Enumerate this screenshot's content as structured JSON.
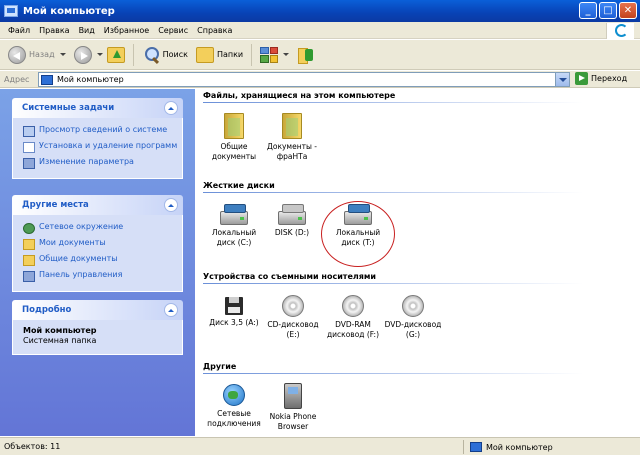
{
  "window": {
    "title": "Мой компьютер"
  },
  "menu": [
    "Файл",
    "Правка",
    "Вид",
    "Избранное",
    "Сервис",
    "Справка"
  ],
  "toolbar": {
    "back": "Назад",
    "search": "Поиск",
    "folders": "Папки"
  },
  "address": {
    "label": "Адрес",
    "value": "Мой компьютер",
    "go": "Переход"
  },
  "left": {
    "system_tasks": {
      "title": "Системные задачи",
      "items": [
        "Просмотр сведений о системе",
        "Установка и удаление программ",
        "Изменение параметра"
      ]
    },
    "other_places": {
      "title": "Другие места",
      "items": [
        "Сетевое окружение",
        "Мои документы",
        "Общие документы",
        "Панель управления"
      ]
    },
    "details": {
      "title": "Подробно",
      "name": "Мой компьютер",
      "type": "Системная папка"
    }
  },
  "groups": {
    "files": {
      "title": "Файлы, хранящиеся на этом компьютере",
      "items": [
        "Общие документы",
        "Документы - фраНТа"
      ]
    },
    "drives": {
      "title": "Жесткие диски",
      "items": [
        "Локальный диск (C:)",
        "DISK (D:)",
        "Локальный диск (T:)"
      ]
    },
    "removable": {
      "title": "Устройства со съемными носителями",
      "items": [
        "Диск 3,5 (A:)",
        "CD-дисковод (E:)",
        "DVD-RAM дисковод (F:)",
        "DVD-дисковод (G:)"
      ]
    },
    "other": {
      "title": "Другие",
      "items": [
        "Сетевые подключения",
        "Nokia Phone Browser"
      ]
    }
  },
  "status": {
    "objects": "Объектов: 11",
    "location": "Мой компьютер"
  },
  "colors": {
    "titlebar": "#0842b5",
    "task_link": "#215dc6",
    "highlight_circle": "#c82020"
  }
}
